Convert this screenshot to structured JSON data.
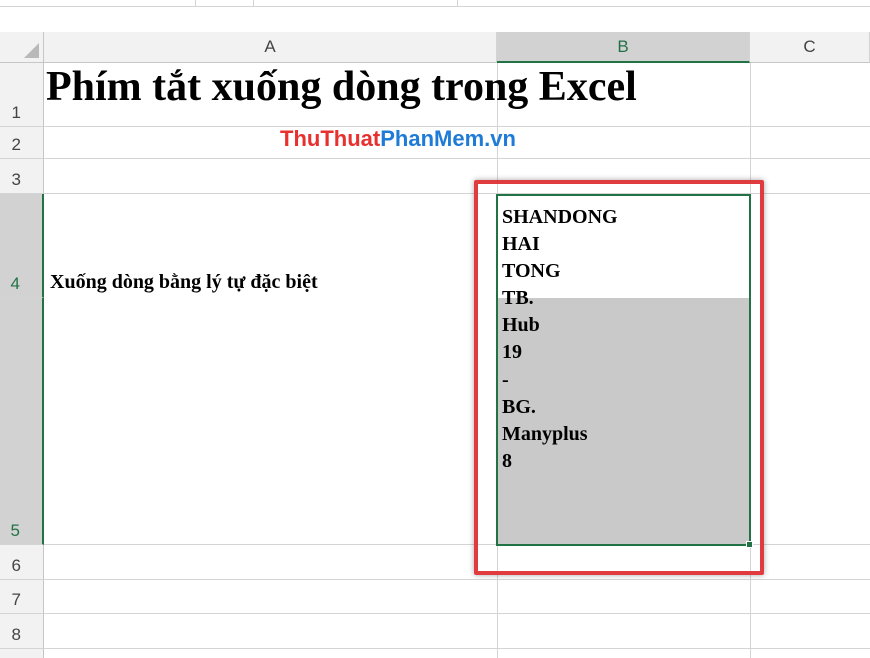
{
  "colors": {
    "accent": "#217346",
    "highlight_box": "#e03c40",
    "brand_red": "#e8302f",
    "brand_blue": "#1f7bd6"
  },
  "columns": [
    "A",
    "B",
    "C"
  ],
  "rows": [
    "1",
    "2",
    "3",
    "4",
    "5",
    "6",
    "7",
    "8"
  ],
  "cells": {
    "A1": "Phím tắt xuống dòng trong Excel",
    "A2_part1": "ThuThuat",
    "A2_part2": "PhanMem.vn",
    "A4": "Xuống dòng bằng lý tự đặc biệt",
    "B4_lines": [
      "SHANDONG",
      "HAI",
      "TONG",
      "TB.",
      "Hub",
      "19",
      "-",
      "BG.",
      "Manyplus",
      "8"
    ]
  }
}
